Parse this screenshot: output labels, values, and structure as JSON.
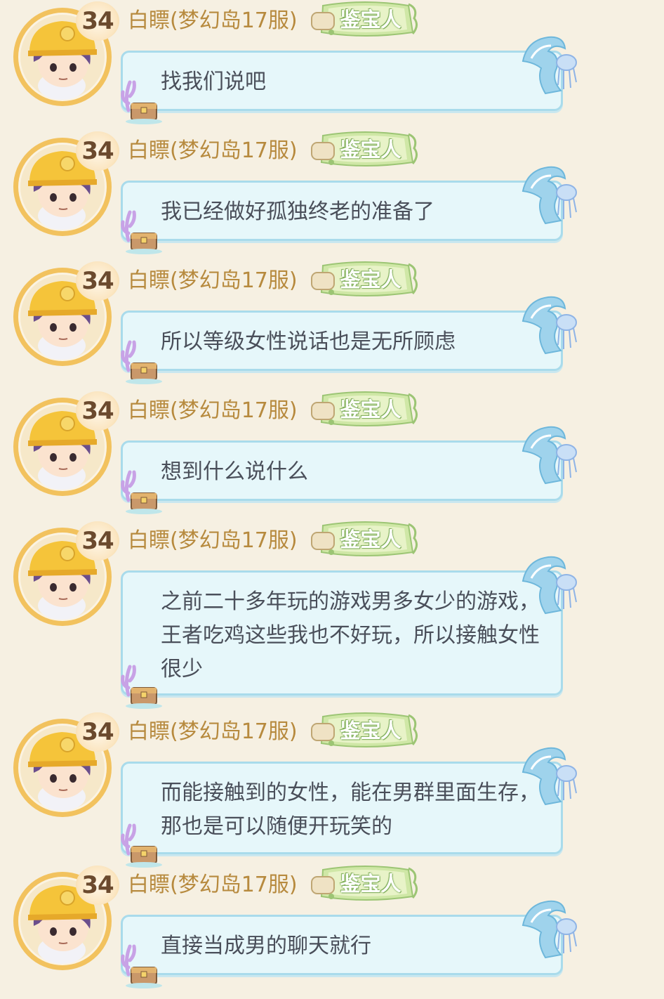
{
  "messages": [
    {
      "level": "34",
      "sender": "白瞟(梦幻岛17服)",
      "badge": "鉴宝人",
      "text": "找我们说吧"
    },
    {
      "level": "34",
      "sender": "白瞟(梦幻岛17服)",
      "badge": "鉴宝人",
      "text": "我已经做好孤独终老的准备了"
    },
    {
      "level": "34",
      "sender": "白瞟(梦幻岛17服)",
      "badge": "鉴宝人",
      "text": "所以等级女性说话也是无所顾虑"
    },
    {
      "level": "34",
      "sender": "白瞟(梦幻岛17服)",
      "badge": "鉴宝人",
      "text": "想到什么说什么"
    },
    {
      "level": "34",
      "sender": "白瞟(梦幻岛17服)",
      "badge": "鉴宝人",
      "text": "之前二十多年玩的游戏男多女少的游戏，王者吃鸡这些我也不好玩，所以接触女性很少"
    },
    {
      "level": "34",
      "sender": "白瞟(梦幻岛17服)",
      "badge": "鉴宝人",
      "text": "而能接触到的女性，能在男群里面生存，那也是可以随便开玩笑的"
    },
    {
      "level": "34",
      "sender": "白瞟(梦幻岛17服)",
      "badge": "鉴宝人",
      "text": "直接当成男的聊天就行"
    }
  ],
  "icons": {
    "avatar": "avatar-hardhat-boy-icon",
    "wave": "wave-jellyfish-icon",
    "coral": "coral-treasure-icon",
    "badge_frame": "scroll-vine-frame-icon"
  },
  "colors": {
    "background": "#f6f0e2",
    "bubble": "#e6f7fa",
    "bubble_border": "#a9dbeb",
    "nickname": "#b78a3e",
    "text": "#4a4f5a"
  }
}
